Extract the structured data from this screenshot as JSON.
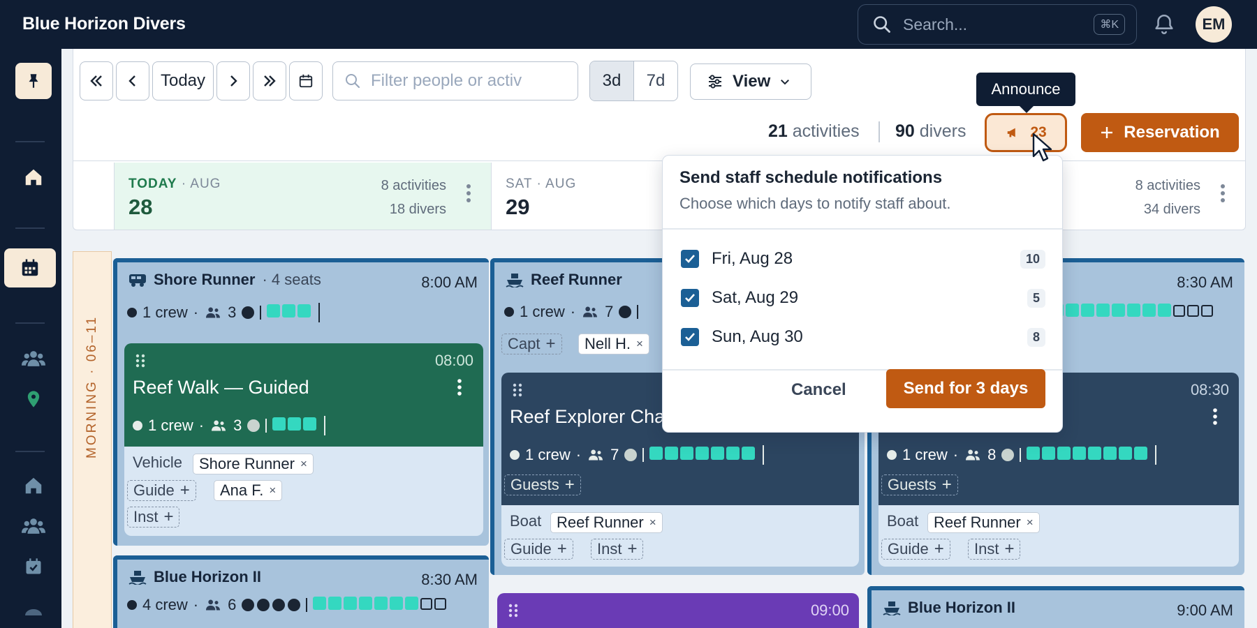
{
  "app": {
    "title": "Blue Horizon Divers"
  },
  "search": {
    "placeholder": "Search...",
    "shortcut": "⌘K"
  },
  "user": {
    "initials": "EM"
  },
  "toolbar": {
    "today_label": "Today",
    "filter_placeholder": "Filter people or activ",
    "range_3d": "3d",
    "range_7d": "7d",
    "view_label": "View",
    "activities_count": "21",
    "activities_label": "activities",
    "divers_count": "90",
    "divers_label": "divers",
    "announce_count": "23",
    "announce_tooltip": "Announce",
    "reservation_label": "Reservation"
  },
  "days": [
    {
      "label_prefix": "TODAY",
      "label_month": "AUG",
      "date": "28",
      "activities": "8 activities",
      "divers": "18 divers"
    },
    {
      "label_prefix": "SAT",
      "label_month": "AUG",
      "date": "29"
    },
    {
      "activities": "8 activities",
      "divers": "34 divers"
    }
  ],
  "timeline": {
    "section": "MORNING · 06–11"
  },
  "cards": {
    "shore_runner": {
      "name": "Shore Runner",
      "seats": "· 4 seats",
      "time": "8:00 AM",
      "crew": "1 crew",
      "sep": "·",
      "people": "3"
    },
    "reef_walk": {
      "drag": "⠿",
      "time": "08:00",
      "name": "Reef Walk — Guided",
      "crew": "1 crew",
      "people": "3",
      "vehicle_label": "Vehicle",
      "vehicle_chip": "Shore Runner",
      "guide_label": "Guide",
      "guide_chip": "Ana F.",
      "inst_label": "Inst"
    },
    "blue_horizon_1": {
      "name": "Blue Horizon II",
      "time": "8:30 AM",
      "crew": "4 crew",
      "people": "6"
    },
    "reef_runner": {
      "name": "Reef Runner",
      "crew": "1 crew",
      "people": "7",
      "capt_label": "Capt",
      "capt_chip": "Nell H."
    },
    "reef_explorer": {
      "time": "",
      "name": "Reef Explorer Char",
      "crew": "1 crew",
      "people": "7",
      "guests_label": "Guests",
      "boat_label": "Boat",
      "boat_chip": "Reef Runner",
      "guide_label": "Guide",
      "inst_label": "Inst"
    },
    "purple": {
      "time": "09:00"
    },
    "right_boat": {
      "time": "8:30 AM"
    },
    "right_act": {
      "time": "08:30",
      "crew": "1 crew",
      "people": "8",
      "guests_label": "Guests",
      "boat_label": "Boat",
      "boat_chip": "Reef Runner",
      "guide_label": "Guide",
      "inst_label": "Inst"
    },
    "blue_horizon_2": {
      "name": "Blue Horizon II",
      "time": "9:00 AM"
    }
  },
  "popover": {
    "title": "Send staff schedule notifications",
    "subtitle": "Choose which days to notify staff about.",
    "options": [
      {
        "label": "Fri, Aug 28",
        "count": "10",
        "checked": true
      },
      {
        "label": "Sat, Aug 29",
        "count": "5",
        "checked": true
      },
      {
        "label": "Sun, Aug 30",
        "count": "8",
        "checked": true
      }
    ],
    "cancel_label": "Cancel",
    "send_label": "Send for 3 days"
  },
  "colors": {
    "brand": "#0f1d33",
    "accent": "#c05a12",
    "teal": "#34d8c0",
    "green": "#1f6b52",
    "slate": "#2c4560",
    "purple": "#6a3bb5"
  }
}
